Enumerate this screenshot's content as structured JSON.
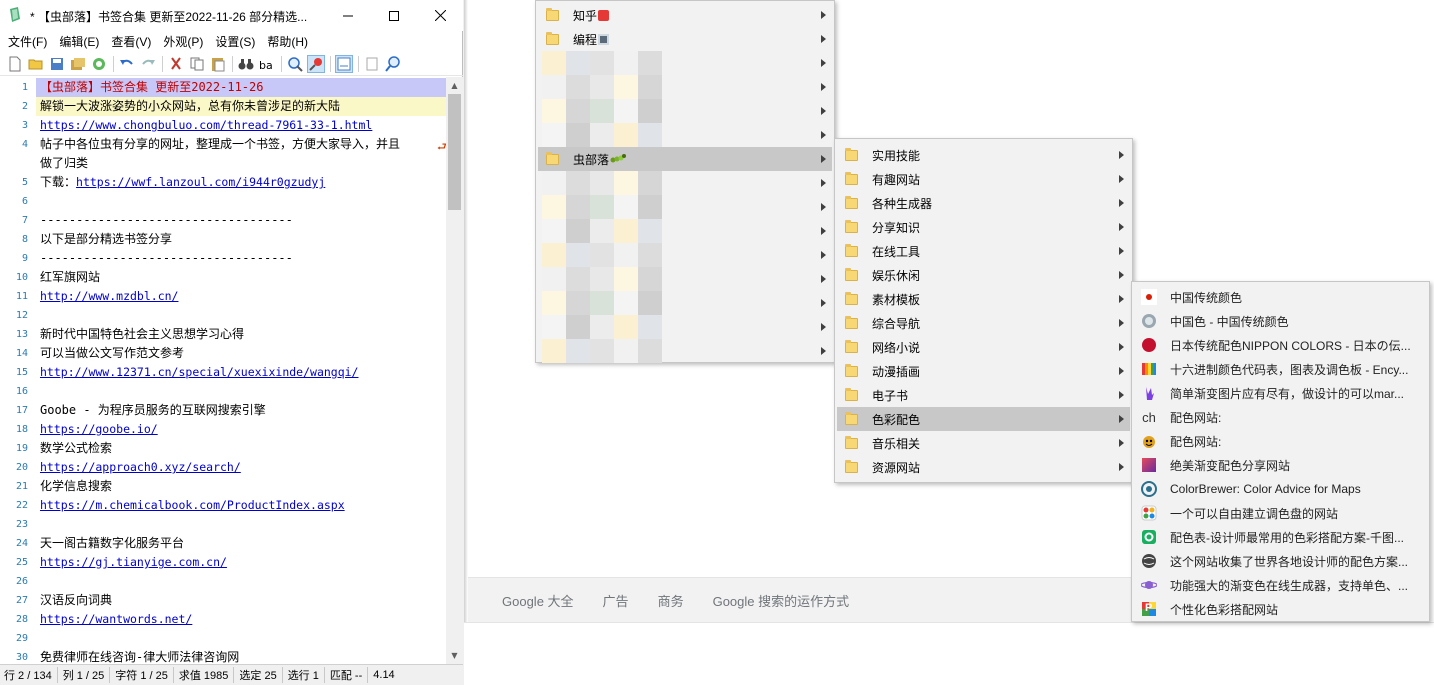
{
  "editor": {
    "title": "* 【虫部落】书签合集 更新至2022-11-26 部分精选...",
    "menu": [
      "文件(F)",
      "编辑(E)",
      "查看(V)",
      "外观(P)",
      "设置(S)",
      "帮助(H)"
    ],
    "lines": [
      {
        "n": "1",
        "text": "【虫部落】书签合集 更新至2022-11-26",
        "kind": "head"
      },
      {
        "n": "2",
        "text": "解锁一大波涨姿势的小众网站，总有你未曾涉足的新大陆",
        "kind": "curline"
      },
      {
        "n": "3",
        "text": "https://www.chongbuluo.com/thread-7961-33-1.html",
        "kind": "url"
      },
      {
        "n": "4",
        "text": "帖子中各位虫有分享的网址，整理成一个书签，方便大家导入，并且",
        "kind": "text"
      },
      {
        "n": "",
        "text": "做了归类",
        "kind": "text"
      },
      {
        "n": "5",
        "text": "下载：",
        "kind": "mixed",
        "url": "https://wwf.lanzoul.com/i944r0gzudyj"
      },
      {
        "n": "6",
        "text": "",
        "kind": "text"
      },
      {
        "n": "7",
        "text": "-----------------------------------",
        "kind": "text"
      },
      {
        "n": "8",
        "text": "以下是部分精选书签分享",
        "kind": "text"
      },
      {
        "n": "9",
        "text": "-----------------------------------",
        "kind": "text"
      },
      {
        "n": "10",
        "text": "红军旗网站",
        "kind": "text"
      },
      {
        "n": "11",
        "text": "http://www.mzdbl.cn/",
        "kind": "url"
      },
      {
        "n": "12",
        "text": "",
        "kind": "text"
      },
      {
        "n": "13",
        "text": "新时代中国特色社会主义思想学习心得",
        "kind": "text"
      },
      {
        "n": "14",
        "text": "可以当做公文写作范文参考",
        "kind": "text"
      },
      {
        "n": "15",
        "text": "http://www.12371.cn/special/xuexixinde/wangqi/",
        "kind": "url"
      },
      {
        "n": "16",
        "text": "",
        "kind": "text"
      },
      {
        "n": "17",
        "text": "Goobe - 为程序员服务的互联网搜索引擎",
        "kind": "text"
      },
      {
        "n": "18",
        "text": "https://goobe.io/",
        "kind": "url"
      },
      {
        "n": "19",
        "text": "数学公式检索",
        "kind": "text"
      },
      {
        "n": "20",
        "text": "https://approach0.xyz/search/",
        "kind": "url"
      },
      {
        "n": "21",
        "text": "化学信息搜索",
        "kind": "text"
      },
      {
        "n": "22",
        "text": "https://m.chemicalbook.com/ProductIndex.aspx",
        "kind": "url"
      },
      {
        "n": "23",
        "text": "",
        "kind": "text"
      },
      {
        "n": "24",
        "text": "天一阁古籍数字化服务平台",
        "kind": "text"
      },
      {
        "n": "25",
        "text": "https://gj.tianyige.com.cn/",
        "kind": "url"
      },
      {
        "n": "26",
        "text": "",
        "kind": "text"
      },
      {
        "n": "27",
        "text": "汉语反向词典",
        "kind": "text"
      },
      {
        "n": "28",
        "text": "https://wantwords.net/",
        "kind": "url"
      },
      {
        "n": "29",
        "text": "",
        "kind": "text"
      },
      {
        "n": "30",
        "text": "免费律师在线咨询-律大师法律咨询网",
        "kind": "text"
      }
    ],
    "status": [
      "行 2 / 134",
      "列 1 / 25",
      "字符 1 / 25",
      "求值 1985",
      "选定 25",
      "选行 1",
      "匹配 --",
      "4.14"
    ]
  },
  "google_footer": [
    "Google 大全",
    "广告",
    "商务",
    "Google 搜索的运作方式"
  ],
  "menu1": {
    "items": [
      {
        "label": "知乎",
        "badge": "red"
      },
      {
        "label": "编程",
        "badge": "disk"
      },
      {
        "label": "",
        "blurred": true
      },
      {
        "label": "",
        "blurred": true
      },
      {
        "label": "",
        "blurred": true
      },
      {
        "label": "",
        "blurred": true
      },
      {
        "label": "虫部落",
        "badge": "bug",
        "selected": true
      },
      {
        "label": "",
        "blurred": true
      },
      {
        "label": "",
        "blurred": true
      },
      {
        "label": "",
        "blurred": true
      },
      {
        "label": "",
        "blurred": true
      },
      {
        "label": "",
        "blurred": true
      },
      {
        "label": "",
        "blurred": true
      },
      {
        "label": "",
        "blurred": true
      },
      {
        "label": "",
        "blurred": true
      }
    ]
  },
  "menu2": {
    "items": [
      "实用技能",
      "有趣网站",
      "各种生成器",
      "分享知识",
      "在线工具",
      "娱乐休闲",
      "素材模板",
      "综合导航",
      "网络小说",
      "动漫插画",
      "电子书",
      "色彩配色",
      "音乐相关",
      "资源网站"
    ],
    "selected_index": 11
  },
  "menu3": {
    "items": [
      {
        "label": "中国传统颜色",
        "icon": "dot-red-icon",
        "color": "#d81e06"
      },
      {
        "label": "中国色 - 中国传统颜色",
        "icon": "gray-circle-icon",
        "color": "#9aa7b0"
      },
      {
        "label": "日本传统配色NIPPON COLORS - 日本の伝...",
        "icon": "red-circle-icon",
        "color": "#c3102f"
      },
      {
        "label": "十六进制颜色代码表，图表及调色板 - Ency...",
        "icon": "rainbow-book-icon",
        "color": "#e53935"
      },
      {
        "label": "简单渐变图片应有尽有，做设计的可以mar...",
        "icon": "hand-icon",
        "color": "#7b3fe4"
      },
      {
        "label": "配色网站:",
        "icon": "ch-icon",
        "color": "#333333",
        "icon_text": "ch"
      },
      {
        "label": "配色网站:",
        "icon": "monkey-icon",
        "color": "#e0a020"
      },
      {
        "label": "绝美渐变配色分享网站",
        "icon": "gradient-square-icon",
        "color": "#b03060"
      },
      {
        "label": "ColorBrewer: Color Advice for Maps",
        "icon": "target-icon",
        "color": "#2a6f8e"
      },
      {
        "label": "一个可以自由建立调色盘的网站",
        "icon": "palette-icon",
        "color": "#f0b020"
      },
      {
        "label": "配色表-设计师最常用的色彩搭配方案-千图...",
        "icon": "green-q-icon",
        "color": "#18b060"
      },
      {
        "label": "这个网站收集了世界各地设计师的配色方案...",
        "icon": "globe-icon",
        "color": "#444444"
      },
      {
        "label": "功能强大的渐变色在线生成器，支持单色、...",
        "icon": "planet-icon",
        "color": "#8a5fd0"
      },
      {
        "label": "个性化色彩搭配网站",
        "icon": "p-icon",
        "color": "#f09030",
        "icon_text": "P"
      }
    ]
  }
}
